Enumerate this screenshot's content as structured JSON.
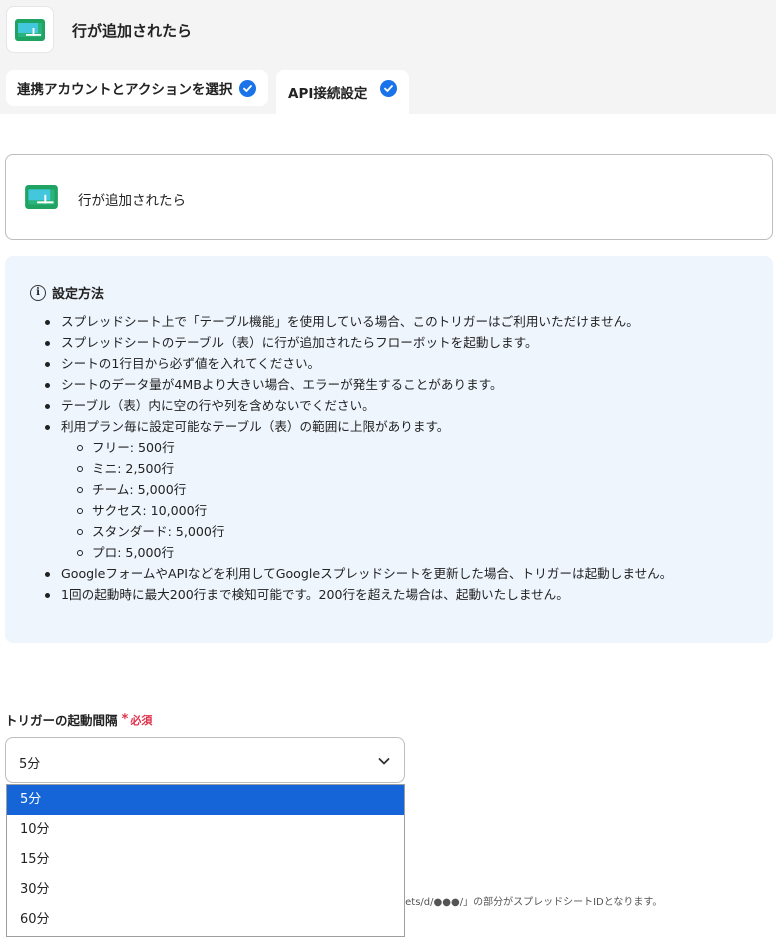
{
  "header": {
    "title": "行が追加されたら",
    "icon": "google-sheets-icon"
  },
  "tabs": [
    {
      "label": "連携アカウントとアクションを選択",
      "status": "complete"
    },
    {
      "label": "API接続設定",
      "status": "complete"
    }
  ],
  "trigger": {
    "label": "行が追加されたら",
    "icon": "google-sheets-icon"
  },
  "info": {
    "heading": "設定方法",
    "items": [
      "スプレッドシート上で「テーブル機能」を使用している場合、このトリガーはご利用いただけません。",
      "スプレッドシートのテーブル（表）に行が追加されたらフローボットを起動します。",
      "シートの1行目から必ず値を入れてください。",
      "シートのデータ量が4MBより大きい場合、エラーが発生することがあります。",
      "テーブル（表）内に空の行や列を含めないでください。",
      "利用プラン毎に設定可能なテーブル（表）の範囲に上限があります。"
    ],
    "plan_limits": [
      "フリー: 500行",
      "ミニ: 2,500行",
      "チーム: 5,000行",
      "サクセス: 10,000行",
      "スタンダード: 5,000行",
      "プロ: 5,000行"
    ],
    "items_after": [
      "GoogleフォームやAPIなどを利用してGoogleスプレッドシートを更新した場合、トリガーは起動しません。",
      "1回の起動時に最大200行まで検知可能です。200行を超えた場合は、起動いたしません。"
    ]
  },
  "interval_field": {
    "label": "トリガーの起動間隔",
    "required_mark": "*",
    "required_text": "必須",
    "value": "5分",
    "options": [
      "5分",
      "10分",
      "15分",
      "30分",
      "60分"
    ],
    "selected_index": 0
  },
  "hint_partial": "eets/d/●●●/」の部分がスプレッドシートIDとなります。",
  "colors": {
    "accent": "#1a73e8",
    "selected_option": "#1565d8",
    "required": "#e0334b",
    "info_bg": "#eef5fd"
  }
}
